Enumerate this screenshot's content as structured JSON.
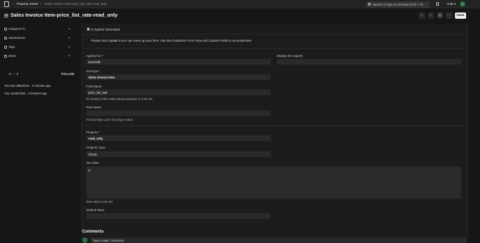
{
  "topbar": {
    "crumbs": [
      "Property Setter",
      "Sales Invoice Item-price_list_rate-read_only"
    ],
    "search_placeholder": "Search or type a command (Ctrl + G)",
    "help_label": "Help",
    "avatar_initial": "A"
  },
  "header": {
    "title": "Sales Invoice Item-price_list_rate-read_only",
    "save_label": "Save"
  },
  "sidebar": {
    "items": [
      {
        "label": "Assigned To"
      },
      {
        "label": "Attachments"
      },
      {
        "label": "Tags"
      },
      {
        "label": "Share"
      }
    ],
    "likes": "0",
    "comments_count": "0",
    "follow_label": "FOLLOW",
    "activity": [
      "You last edited this · 2 minutes ago",
      "You created this · 2 minutes ago"
    ]
  },
  "form": {
    "is_system_generated_label": "Is System Generated",
    "notice": "Please don't update it as it can mess up your form. Use the Customize Form View and Custom Fields to set properties!",
    "applied_on_label": "Applied On *",
    "applied_on_value": "DocField",
    "module_label": "Module (for export)",
    "module_value": "",
    "doctype_label": "DocType *",
    "doctype_value": "Sales Invoice Item",
    "field_name_label": "Field Name",
    "field_name_value": "price_list_rate",
    "field_name_desc": "ID (name) of the entity whose property is to be set",
    "row_name_label": "Row Name",
    "row_name_value": "",
    "row_name_desc": "For DocType Link / DocType Action",
    "property_label": "Property *",
    "property_value": "read_only",
    "property_type_label": "Property Type",
    "property_type_value": "Check",
    "set_value_label": "Set Value",
    "set_value_value": "0",
    "set_value_desc": "New value to be set",
    "default_value_label": "Default Value",
    "default_value_value": ""
  },
  "comments": {
    "title": "Comments",
    "placeholder": "Type a reply / comment"
  }
}
